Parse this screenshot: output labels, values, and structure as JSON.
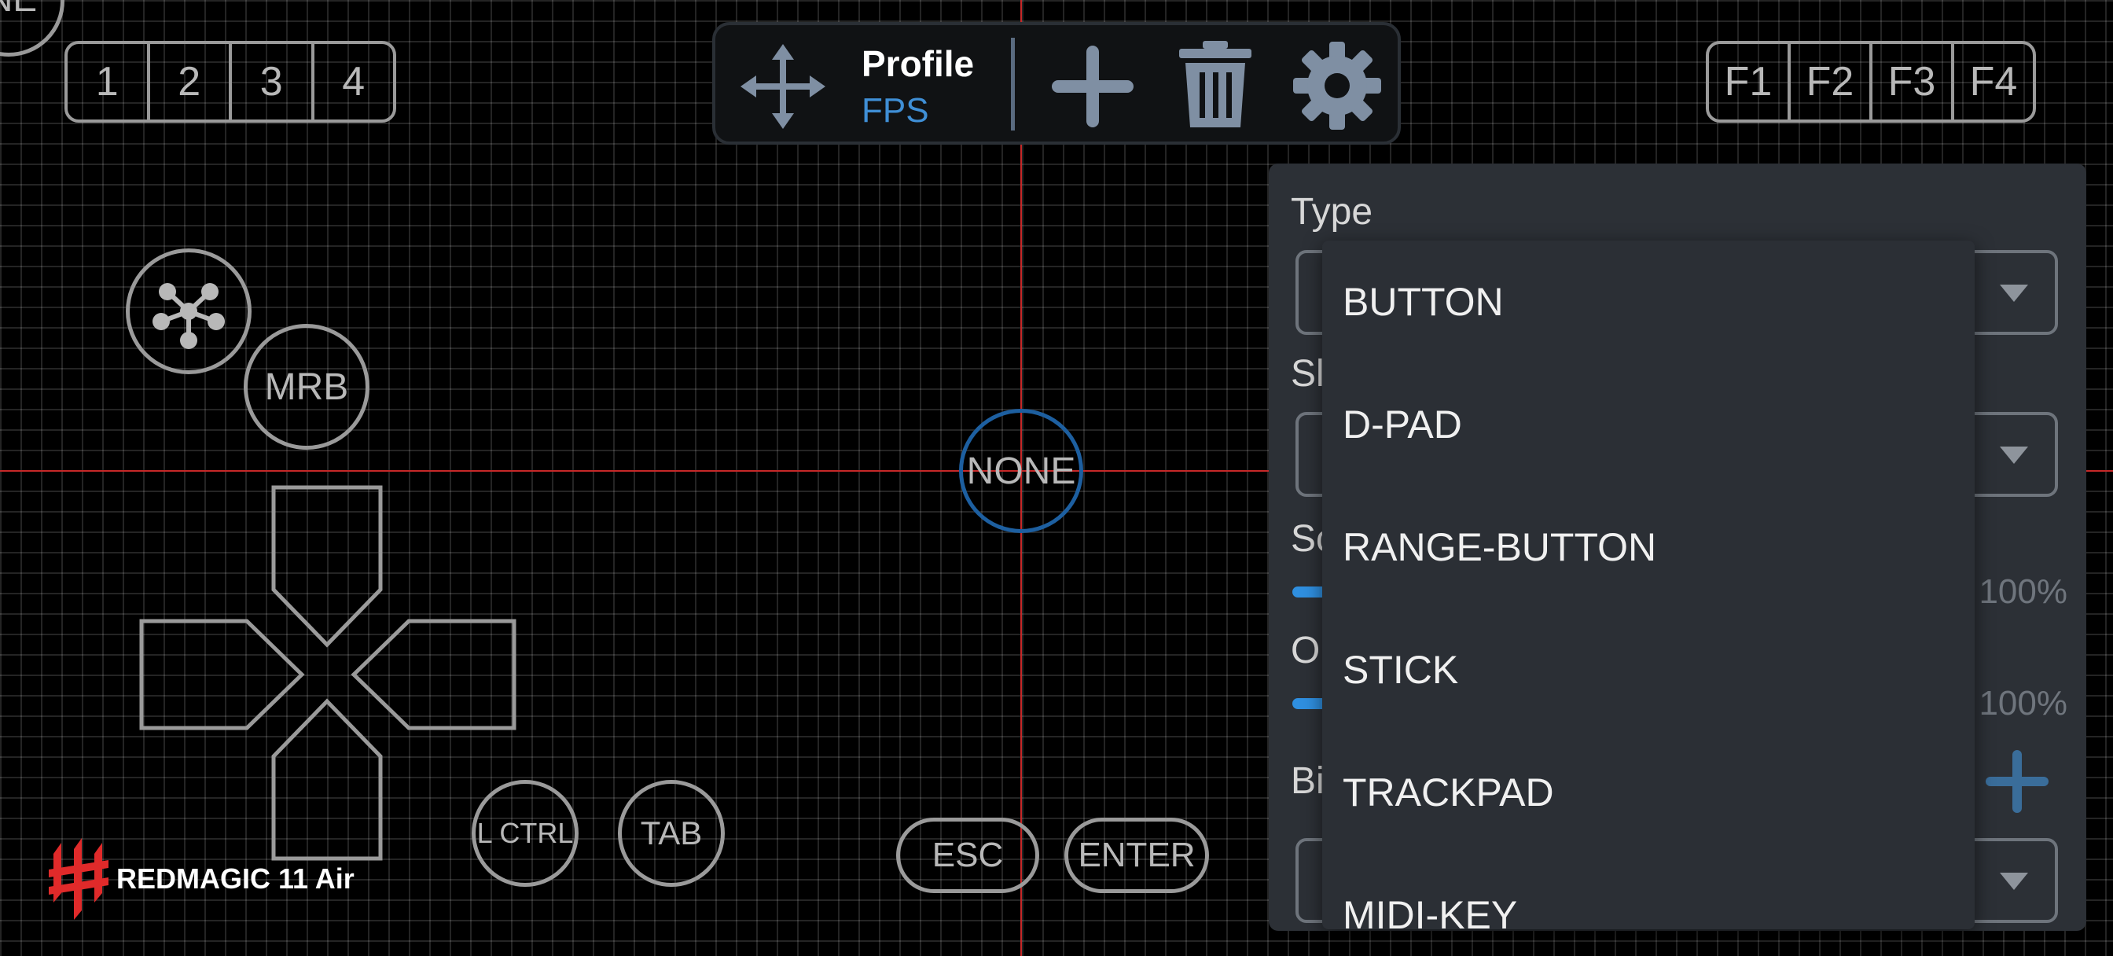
{
  "top_left_badge": "NE",
  "number_keys": [
    "1",
    "2",
    "3",
    "4"
  ],
  "function_keys": [
    "F1",
    "F2",
    "F3",
    "F4"
  ],
  "toolbar": {
    "profile_label": "Profile",
    "profile_value": "FPS"
  },
  "controls": {
    "mrb": "MRB",
    "center": "NONE",
    "lctrl": "L CTRL",
    "tab": "TAB",
    "esc": "ESC",
    "enter": "ENTER"
  },
  "panel": {
    "type_label": "Type",
    "row2_label_partial": "Sl",
    "row3_label_partial": "Sc",
    "row3_value": "100%",
    "row4_label_partial": "O",
    "row4_value": "100%",
    "row5_label_partial": "Bi"
  },
  "dropdown": {
    "options": [
      "BUTTON",
      "D-PAD",
      "RANGE-BUTTON",
      "STICK",
      "TRACKPAD",
      "MIDI-KEY"
    ]
  },
  "brand": {
    "text": "REDMAGIC 11 Air"
  },
  "colors": {
    "accent": "#3f8fd6",
    "crosshair": "#c62828",
    "brand_red": "#e02a2a"
  }
}
